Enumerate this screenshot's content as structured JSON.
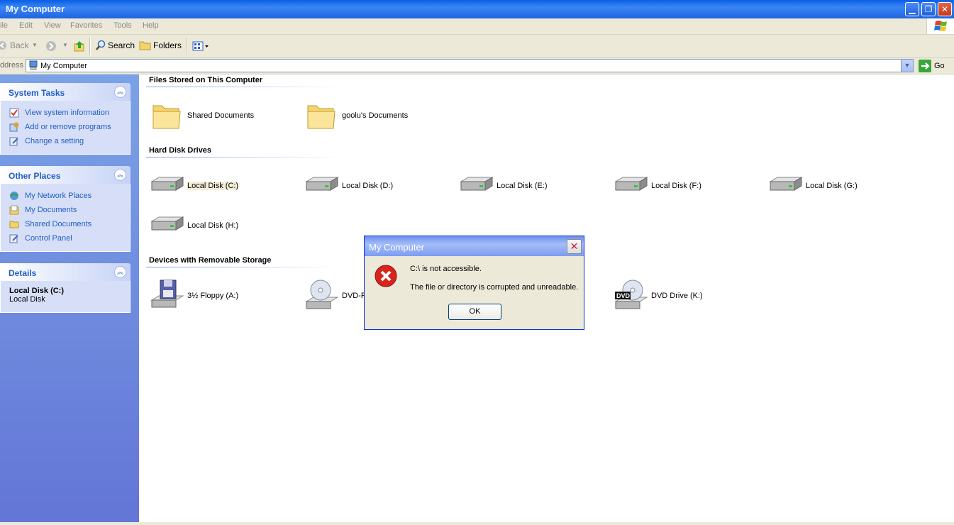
{
  "window": {
    "title": "My Computer",
    "min_glyph": "▁",
    "restore_glyph": "❐",
    "close_glyph": "✕"
  },
  "menu": [
    "ile",
    "Edit",
    "View",
    "Favorites",
    "Tools",
    "Help"
  ],
  "toolbar": {
    "back": "Back",
    "search": "Search",
    "folders": "Folders"
  },
  "address": {
    "label": "ddress",
    "value": "My Computer",
    "go": "Go"
  },
  "sidebar": {
    "system_tasks": {
      "title": "System Tasks",
      "items": [
        {
          "label": "View system information",
          "icon": "system-info-icon"
        },
        {
          "label": "Add or remove programs",
          "icon": "add-remove-icon"
        },
        {
          "label": "Change a setting",
          "icon": "settings-icon"
        }
      ]
    },
    "other_places": {
      "title": "Other Places",
      "items": [
        {
          "label": "My Network Places",
          "icon": "network-icon"
        },
        {
          "label": "My Documents",
          "icon": "documents-icon"
        },
        {
          "label": "Shared Documents",
          "icon": "folder-icon"
        },
        {
          "label": "Control Panel",
          "icon": "control-panel-icon"
        }
      ]
    },
    "details": {
      "title": "Details",
      "name": "Local Disk (C:)",
      "type": "Local Disk"
    }
  },
  "sections": {
    "files": {
      "title": "Files Stored on This Computer",
      "items": [
        "Shared Documents",
        "goolu's Documents"
      ]
    },
    "hard_disks": {
      "title": "Hard Disk Drives",
      "items": [
        "Local Disk (C:)",
        "Local Disk (D:)",
        "Local Disk (E:)",
        "Local Disk (F:)",
        "Local Disk (G:)",
        "Local Disk (H:)"
      ]
    },
    "removable": {
      "title": "Devices with Removable Storage",
      "items": [
        "3½ Floppy (A:)",
        "DVD-R",
        "DVD Drive (K:)"
      ]
    }
  },
  "dialog": {
    "title": "My Computer",
    "message1": "C:\\ is not accessible.",
    "message2": "The file or directory is corrupted and unreadable.",
    "ok": "OK",
    "close_glyph": "✕"
  },
  "colors": {
    "title_blue": "#0a5ee6",
    "sidebar_blue": "#7ba2e7",
    "link_blue": "#215dc6",
    "error_red": "#d8241c"
  }
}
